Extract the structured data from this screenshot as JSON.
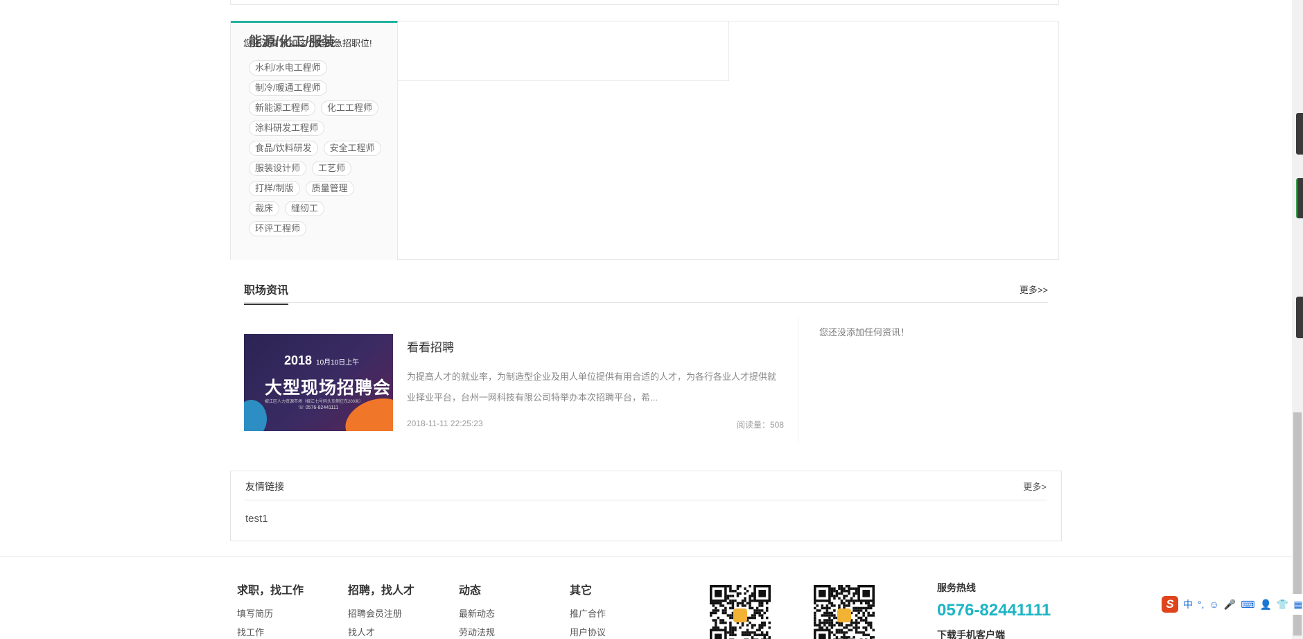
{
  "category": {
    "title": "能源/化工/服装",
    "tag_rows": [
      [
        "水利/水电工程师"
      ],
      [
        "制冷/暖通工程师"
      ],
      [
        "新能源工程师",
        "化工工程师"
      ],
      [
        "涂料研发工程师"
      ],
      [
        "食品/饮料研发",
        "安全工程师"
      ],
      [
        "服装设计师",
        "工艺师"
      ],
      [
        "打样/制版",
        "质量管理"
      ],
      [
        "裁床",
        "缝纫工"
      ],
      [
        "环评工程师"
      ]
    ],
    "empty_message": "您还没有添加这个类别急招职位!"
  },
  "news": {
    "tab_label": "职场资讯",
    "more_label": "更多>>",
    "article": {
      "title": "看看招聘",
      "description": "为提高人才的就业率，为制造型企业及用人单位提供有用合适的人才，为各行各业人才提供就业择业平台，台州一网科技有限公司特举办本次招聘平台，希...",
      "date": "2018-11-11 22:25:23",
      "reads": "阅读量：508",
      "image_text": {
        "year": "2018",
        "date": "10月10日上午",
        "headline": "大型现场招聘会",
        "address": "椒江区人力资源市场（椒江七号码头东侧往东200米）",
        "phone": "☏ 0576-82441111"
      }
    },
    "empty_message": "您还没添加任何资讯！"
  },
  "links": {
    "title": "友情链接",
    "more_label": "更多>",
    "items": [
      "test1"
    ]
  },
  "footer": {
    "columns": [
      {
        "title": "求职，找工作",
        "links": [
          "填写简历",
          "找工作"
        ]
      },
      {
        "title": "招聘，找人才",
        "links": [
          "招聘会员注册",
          "找人才"
        ]
      },
      {
        "title": "动态",
        "links": [
          "最新动态",
          "劳动法规"
        ]
      },
      {
        "title": "其它",
        "links": [
          "推广合作",
          "用户协议"
        ]
      }
    ],
    "hotline_label": "服务热线",
    "hotline_number": "0576-82441111",
    "download_label": "下载手机客户端"
  },
  "ime_toolbar": {
    "logo": "S",
    "items": [
      "中",
      "°,",
      "☺",
      "🎤",
      "⌨",
      "👤",
      "👕",
      "▦"
    ]
  },
  "colors": {
    "accent": "#1fb19e",
    "hotline": "#1cb5c4"
  }
}
